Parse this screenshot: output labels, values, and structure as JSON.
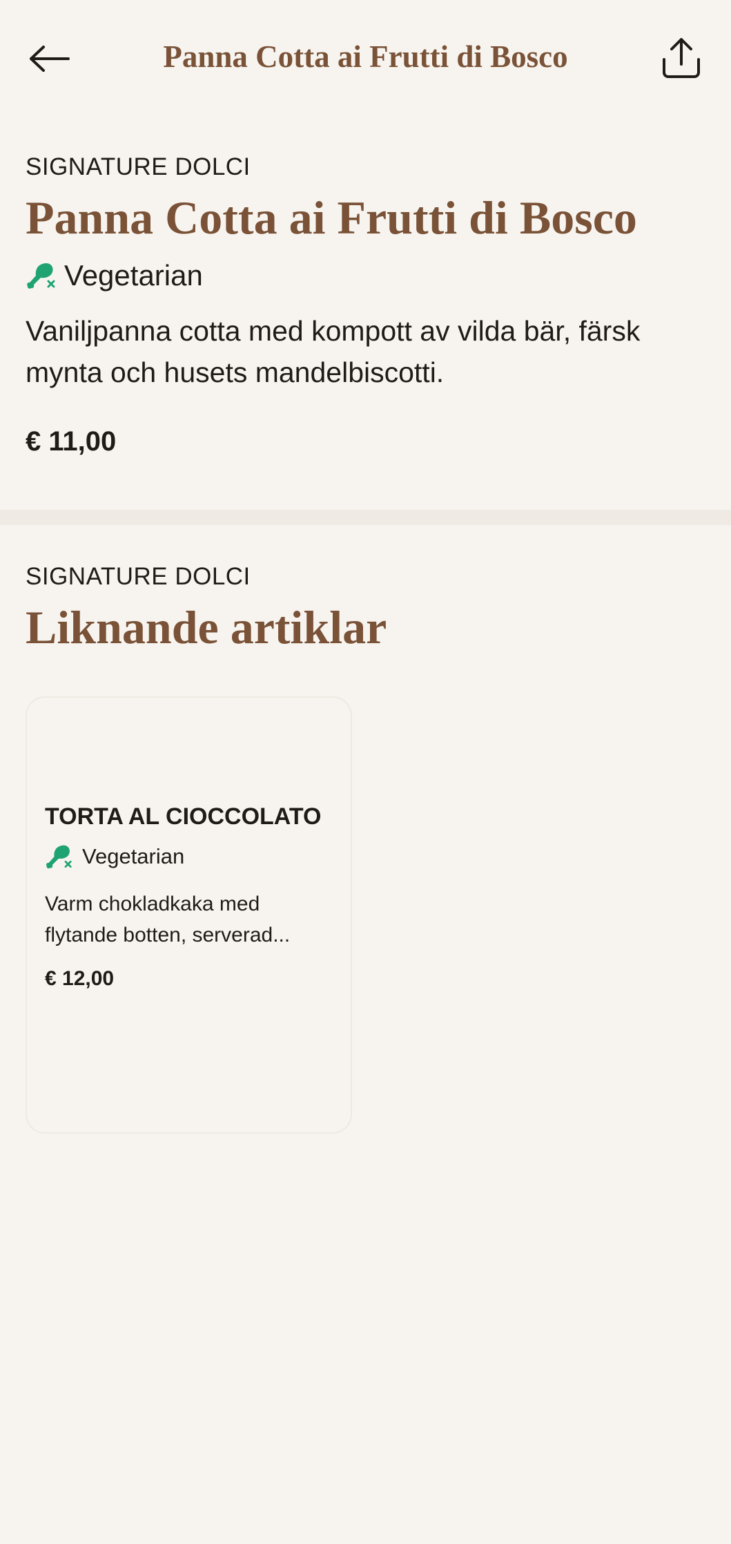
{
  "header": {
    "title": "Panna Cotta ai Frutti di Bosco",
    "back_icon": "arrow-left-icon",
    "share_icon": "share-icon"
  },
  "product": {
    "category": "SIGNATURE DOLCI",
    "name": "Panna Cotta ai Frutti di Bosco",
    "diet_label": "Vegetarian",
    "diet_icon": "vegetarian-drumstick-crossed-icon",
    "description": "Vaniljpanna cotta med kompott av vilda bär, färsk mynta och husets mandelbiscotti.",
    "price": "€ 11,00"
  },
  "similar": {
    "category": "SIGNATURE DOLCI",
    "heading": "Liknande artiklar",
    "items": [
      {
        "name": "TORTA AL CIOCCOLATO",
        "diet_label": "Vegetarian",
        "description": "Varm chokladkaka med flytande botten, serverad...",
        "price": "€ 12,00"
      }
    ]
  },
  "colors": {
    "background": "#f7f4ef",
    "accent_brown": "#7a5237",
    "text": "#1f1b16",
    "vegetarian_green": "#1fa372",
    "divider": "#efebe4"
  }
}
